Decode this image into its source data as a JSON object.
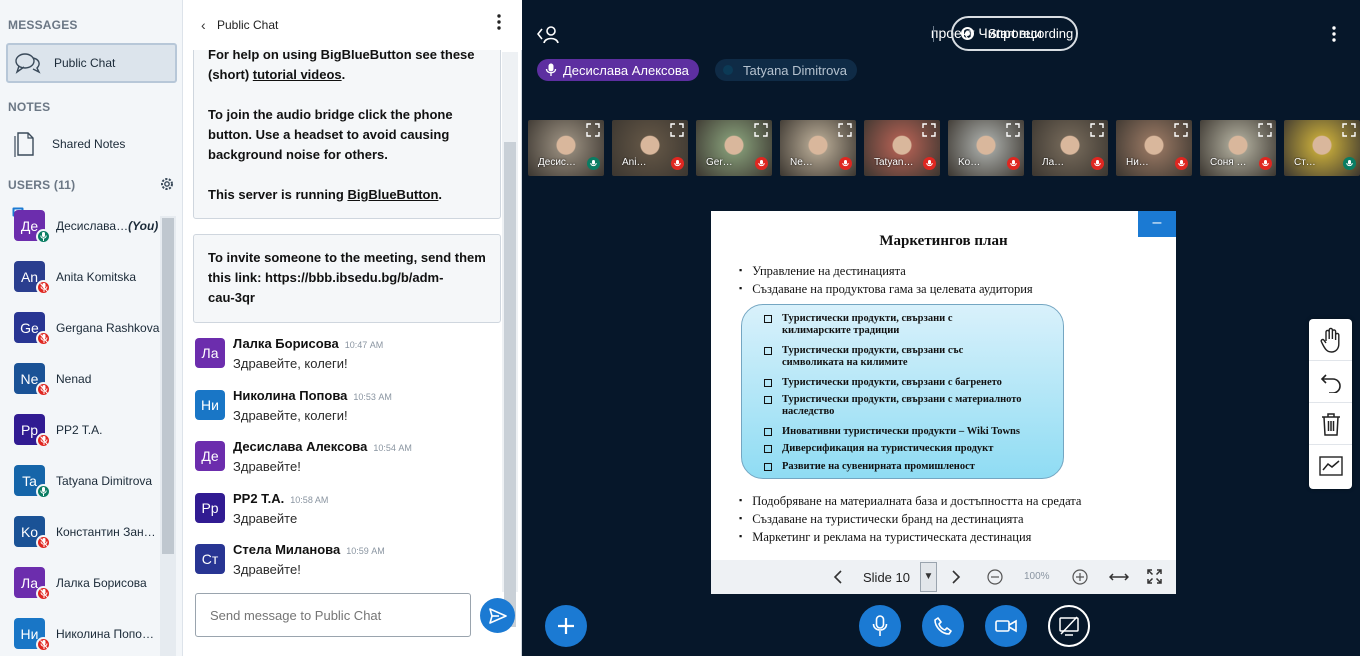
{
  "sidebar": {
    "messages_label": "MESSAGES",
    "public_chat_label": "Public Chat",
    "notes_label": "NOTES",
    "shared_notes_label": "Shared Notes",
    "users_label": "USERS (11)",
    "users": [
      {
        "initials": "Де",
        "name": "Десислава…",
        "you": "(You)",
        "color": "#6c2dad",
        "mic": "on"
      },
      {
        "initials": "An",
        "name": "Anita Komitska",
        "you": "",
        "color": "#2a3e8f",
        "mic": "muted"
      },
      {
        "initials": "Ge",
        "name": "Gergana Rashkova",
        "you": "",
        "color": "#283593",
        "mic": "muted"
      },
      {
        "initials": "Ne",
        "name": "Nenad",
        "you": "",
        "color": "#1a5296",
        "mic": "muted"
      },
      {
        "initials": "Pp",
        "name": "PP2 T.A.",
        "you": "",
        "color": "#311b92",
        "mic": "muted"
      },
      {
        "initials": "Ta",
        "name": "Tatyana Dimitrova",
        "you": "",
        "color": "#1565a9",
        "mic": "on"
      },
      {
        "initials": "Ko",
        "name": "Константин Зан…",
        "you": "",
        "color": "#1a5296",
        "mic": "muted"
      },
      {
        "initials": "Ла",
        "name": "Лалка Борисова",
        "you": "",
        "color": "#6c2dad",
        "mic": "muted"
      },
      {
        "initials": "Ни",
        "name": "Николина Попо…",
        "you": "",
        "color": "#1976c6",
        "mic": "muted"
      }
    ]
  },
  "chat": {
    "title": "Public Chat",
    "sys1": {
      "line1": "For help on using BigBlueButton see these",
      "line2_prefix": "(short) ",
      "line2_link": "tutorial videos",
      "line2_suffix": ".",
      "line3": "To join the audio bridge click the phone",
      "line4": "button. Use a headset to avoid causing",
      "line5": "background noise for others.",
      "line6_prefix": "This server is running ",
      "line6_link": "BigBlueButton",
      "line6_suffix": "."
    },
    "sys2": {
      "line1": "To invite someone to the meeting, send them",
      "line2": "this link: https://bbb.ibsedu.bg/b/adm-",
      "line3": "cau-3qr"
    },
    "messages": [
      {
        "initials": "Ла",
        "color": "#6c2dad",
        "name": "Лалка Борисова",
        "time": "10:47 AM",
        "text": "Здравейте, колеги!"
      },
      {
        "initials": "Ни",
        "color": "#1976c6",
        "name": "Николина Попова",
        "time": "10:53 AM",
        "text": "Здравейте, колеги!"
      },
      {
        "initials": "Де",
        "color": "#6c2dad",
        "name": "Десислава Алексова",
        "time": "10:54 AM",
        "text": "Здравейте!"
      },
      {
        "initials": "Pp",
        "color": "#311b92",
        "name": "PP2 T.A.",
        "time": "10:58 AM",
        "text": "Здравейте"
      },
      {
        "initials": "Ст",
        "color": "#283593",
        "name": "Стела Миланова",
        "time": "10:59 AM",
        "text": "Здравейте!"
      }
    ],
    "input_placeholder": "Send message to Public Chat"
  },
  "main": {
    "meeting_title": "проект Чипровци",
    "record_label": "Start recording",
    "talkers": [
      {
        "name": "Десислава Алексова",
        "state": "talking"
      },
      {
        "name": "Tatyana Dimitrova",
        "state": "idle"
      }
    ],
    "tiles": [
      {
        "name": "Десис…",
        "mic": "on",
        "bg": "#8d8375"
      },
      {
        "name": "Ani…",
        "mic": "muted",
        "bg": "#5e5243"
      },
      {
        "name": "Ger…",
        "mic": "muted",
        "bg": "#7d9170"
      },
      {
        "name": "Ne…",
        "mic": "muted",
        "bg": "#a69a87"
      },
      {
        "name": "Tatyan…",
        "mic": "muted",
        "bg": "#a35b4f"
      },
      {
        "name": "Ko…",
        "mic": "muted",
        "bg": "#9a9c98"
      },
      {
        "name": "Ла…",
        "mic": "muted",
        "bg": "#6d6254"
      },
      {
        "name": "Ни…",
        "mic": "muted",
        "bg": "#8c6f5c"
      },
      {
        "name": "Соня …",
        "mic": "muted",
        "bg": "#a09d8e"
      },
      {
        "name": "Ст…",
        "mic": "on",
        "bg": "#b89f3a"
      }
    ]
  },
  "slide": {
    "title": "Маркетингов план",
    "top_bullets": [
      "Управление на дестинацията",
      "Създаване на продуктова гама за целевата аудитория"
    ],
    "boxed_items": [
      [
        "Туристически продукти, свързани с",
        "килимарските традиции"
      ],
      [
        "Туристически продукти, свързани със",
        "символиката на килимите"
      ],
      [
        "Туристически продукти, свързани с багренето"
      ],
      [
        "Туристически продукти, свързани с материалното",
        "наследство"
      ],
      [
        "Иновативни туристически продукти – Wiki Towns"
      ],
      [
        "Диверсификация на туристическия продукт"
      ],
      [
        "Развитие на сувенирната промишленост"
      ]
    ],
    "bottom_bullets": [
      "Подобряване на материалната база и достъпността на средата",
      "Създаване на туристически бранд на дестинацията",
      "Маркетинг и реклама на туристическата дестинация"
    ],
    "slide_label": "Slide 10",
    "zoom": "100%",
    "minimize_glyph": "–"
  },
  "colors": {
    "accent": "#1b7ad3",
    "muted": "#df2721",
    "talking": "#0a7d63",
    "bg": "#06172a"
  }
}
